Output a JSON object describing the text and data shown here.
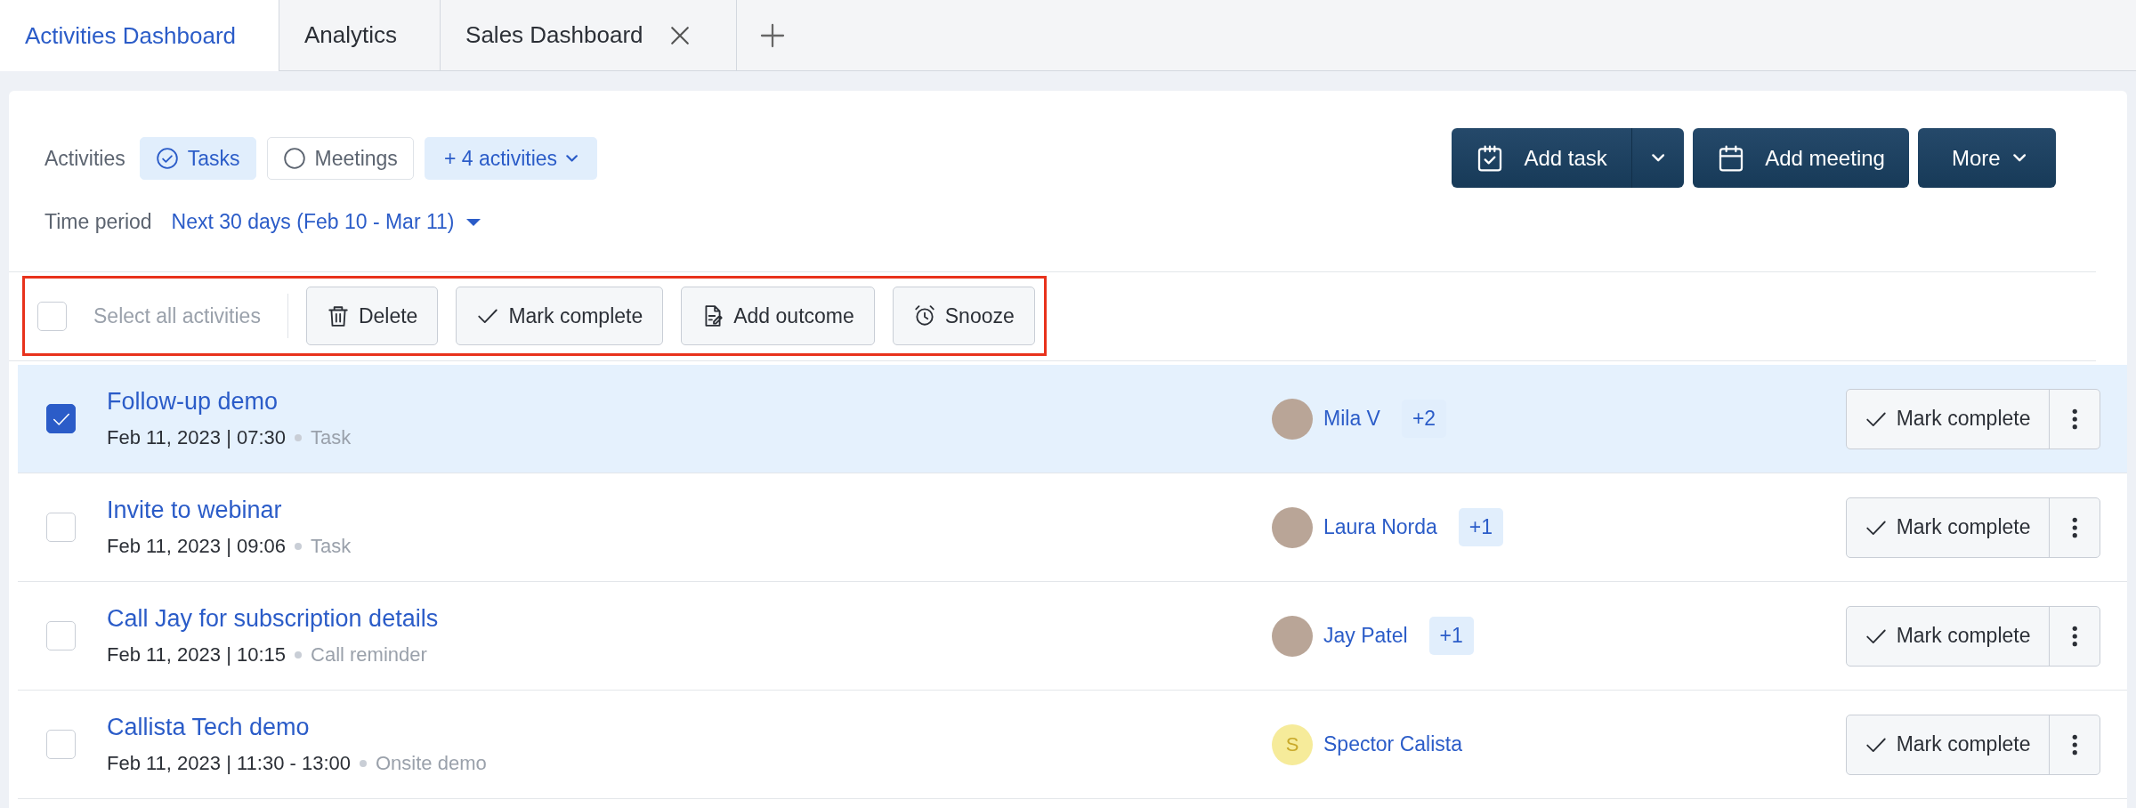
{
  "tabs": [
    {
      "label": "Activities Dashboard",
      "selected": true,
      "closable": false
    },
    {
      "label": "Analytics",
      "selected": false,
      "closable": false
    },
    {
      "label": "Sales Dashboard",
      "selected": false,
      "closable": true
    }
  ],
  "filters": {
    "label": "Activities",
    "chips": [
      {
        "label": "Tasks",
        "selected": true
      },
      {
        "label": "Meetings",
        "selected": false
      }
    ],
    "more": "+ 4 activities"
  },
  "time_period": {
    "label": "Time period",
    "value": "Next 30 days (Feb 10 - Mar 11)"
  },
  "actions": [
    "Add task",
    "Add meeting",
    "More"
  ],
  "bulk_bar": {
    "select_all": {
      "label": "Select all activities",
      "checked": false
    },
    "buttons": [
      "Delete",
      "Mark complete",
      "Add outcome",
      "Snooze"
    ]
  },
  "activities": [
    {
      "title": "Follow-up demo",
      "datetime": "Feb 11, 2023 | 07:30",
      "type": "Task",
      "checked": true,
      "assignee": {
        "name": "Mila V",
        "kind": "photo",
        "extra": "+2"
      },
      "action": "Mark complete"
    },
    {
      "title": "Invite to webinar",
      "datetime": "Feb 11, 2023 | 09:06",
      "type": "Task",
      "checked": false,
      "assignee": {
        "name": "Laura Norda",
        "kind": "photo",
        "extra": "+1"
      },
      "action": "Mark complete"
    },
    {
      "title": "Call Jay for subscription details",
      "datetime": "Feb 11, 2023 | 10:15",
      "type": "Call reminder",
      "checked": false,
      "assignee": {
        "name": "Jay Patel",
        "kind": "photo",
        "extra": "+1"
      },
      "action": "Mark complete"
    },
    {
      "title": "Callista Tech demo",
      "datetime": "Feb 11, 2023 | 11:30 - 13:00",
      "type": "Onsite demo",
      "checked": false,
      "assignee": {
        "name": "Spector Calista",
        "kind": "initials",
        "initial": "S"
      },
      "action": "Mark complete"
    }
  ]
}
